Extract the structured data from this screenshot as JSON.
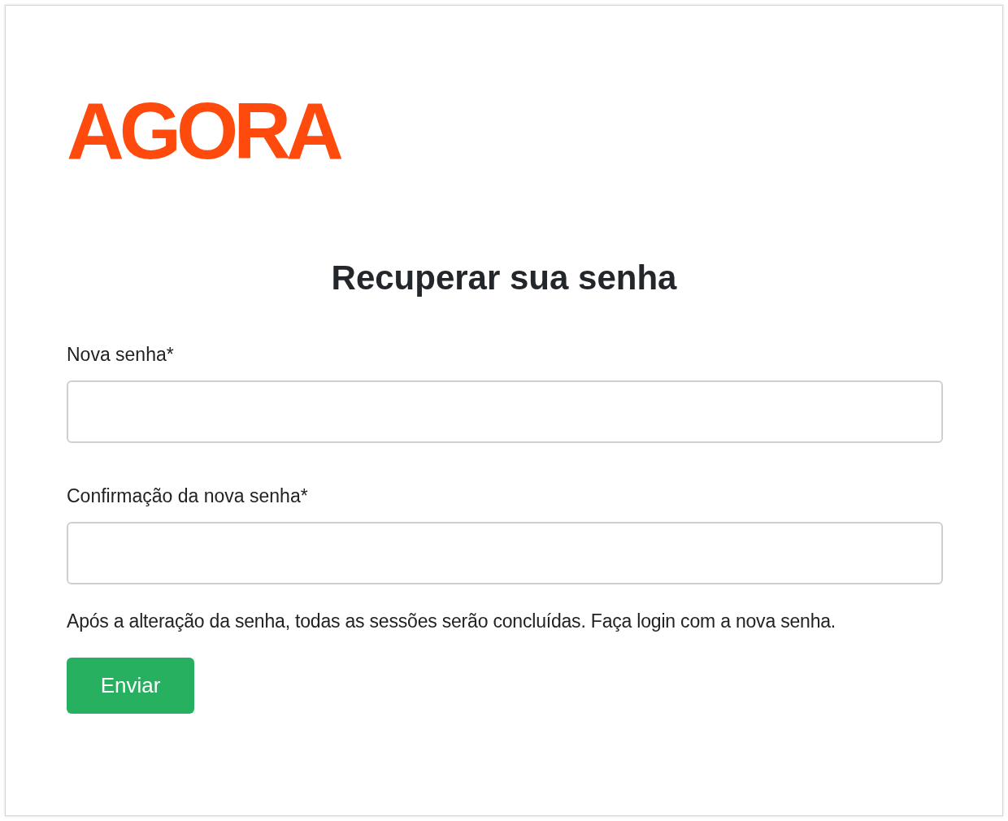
{
  "logo": {
    "text": "AGORA"
  },
  "title": "Recuperar sua senha",
  "fields": [
    {
      "label": "Nova senha*"
    },
    {
      "label": "Confirmação da nova senha*"
    }
  ],
  "note": "Após a alteração da senha, todas as sessões serão concluídas. Faça login com a nova senha.",
  "submit_button": "Enviar"
}
